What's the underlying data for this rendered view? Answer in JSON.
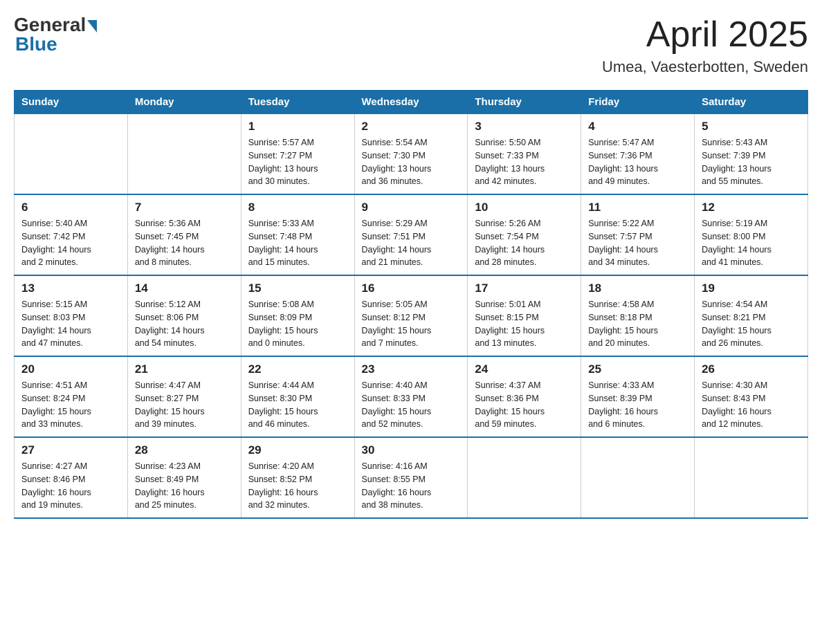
{
  "logo": {
    "general": "General",
    "blue": "Blue"
  },
  "title": "April 2025",
  "subtitle": "Umea, Vaesterbotten, Sweden",
  "days_of_week": [
    "Sunday",
    "Monday",
    "Tuesday",
    "Wednesday",
    "Thursday",
    "Friday",
    "Saturday"
  ],
  "weeks": [
    [
      {
        "day": "",
        "info": ""
      },
      {
        "day": "",
        "info": ""
      },
      {
        "day": "1",
        "info": "Sunrise: 5:57 AM\nSunset: 7:27 PM\nDaylight: 13 hours\nand 30 minutes."
      },
      {
        "day": "2",
        "info": "Sunrise: 5:54 AM\nSunset: 7:30 PM\nDaylight: 13 hours\nand 36 minutes."
      },
      {
        "day": "3",
        "info": "Sunrise: 5:50 AM\nSunset: 7:33 PM\nDaylight: 13 hours\nand 42 minutes."
      },
      {
        "day": "4",
        "info": "Sunrise: 5:47 AM\nSunset: 7:36 PM\nDaylight: 13 hours\nand 49 minutes."
      },
      {
        "day": "5",
        "info": "Sunrise: 5:43 AM\nSunset: 7:39 PM\nDaylight: 13 hours\nand 55 minutes."
      }
    ],
    [
      {
        "day": "6",
        "info": "Sunrise: 5:40 AM\nSunset: 7:42 PM\nDaylight: 14 hours\nand 2 minutes."
      },
      {
        "day": "7",
        "info": "Sunrise: 5:36 AM\nSunset: 7:45 PM\nDaylight: 14 hours\nand 8 minutes."
      },
      {
        "day": "8",
        "info": "Sunrise: 5:33 AM\nSunset: 7:48 PM\nDaylight: 14 hours\nand 15 minutes."
      },
      {
        "day": "9",
        "info": "Sunrise: 5:29 AM\nSunset: 7:51 PM\nDaylight: 14 hours\nand 21 minutes."
      },
      {
        "day": "10",
        "info": "Sunrise: 5:26 AM\nSunset: 7:54 PM\nDaylight: 14 hours\nand 28 minutes."
      },
      {
        "day": "11",
        "info": "Sunrise: 5:22 AM\nSunset: 7:57 PM\nDaylight: 14 hours\nand 34 minutes."
      },
      {
        "day": "12",
        "info": "Sunrise: 5:19 AM\nSunset: 8:00 PM\nDaylight: 14 hours\nand 41 minutes."
      }
    ],
    [
      {
        "day": "13",
        "info": "Sunrise: 5:15 AM\nSunset: 8:03 PM\nDaylight: 14 hours\nand 47 minutes."
      },
      {
        "day": "14",
        "info": "Sunrise: 5:12 AM\nSunset: 8:06 PM\nDaylight: 14 hours\nand 54 minutes."
      },
      {
        "day": "15",
        "info": "Sunrise: 5:08 AM\nSunset: 8:09 PM\nDaylight: 15 hours\nand 0 minutes."
      },
      {
        "day": "16",
        "info": "Sunrise: 5:05 AM\nSunset: 8:12 PM\nDaylight: 15 hours\nand 7 minutes."
      },
      {
        "day": "17",
        "info": "Sunrise: 5:01 AM\nSunset: 8:15 PM\nDaylight: 15 hours\nand 13 minutes."
      },
      {
        "day": "18",
        "info": "Sunrise: 4:58 AM\nSunset: 8:18 PM\nDaylight: 15 hours\nand 20 minutes."
      },
      {
        "day": "19",
        "info": "Sunrise: 4:54 AM\nSunset: 8:21 PM\nDaylight: 15 hours\nand 26 minutes."
      }
    ],
    [
      {
        "day": "20",
        "info": "Sunrise: 4:51 AM\nSunset: 8:24 PM\nDaylight: 15 hours\nand 33 minutes."
      },
      {
        "day": "21",
        "info": "Sunrise: 4:47 AM\nSunset: 8:27 PM\nDaylight: 15 hours\nand 39 minutes."
      },
      {
        "day": "22",
        "info": "Sunrise: 4:44 AM\nSunset: 8:30 PM\nDaylight: 15 hours\nand 46 minutes."
      },
      {
        "day": "23",
        "info": "Sunrise: 4:40 AM\nSunset: 8:33 PM\nDaylight: 15 hours\nand 52 minutes."
      },
      {
        "day": "24",
        "info": "Sunrise: 4:37 AM\nSunset: 8:36 PM\nDaylight: 15 hours\nand 59 minutes."
      },
      {
        "day": "25",
        "info": "Sunrise: 4:33 AM\nSunset: 8:39 PM\nDaylight: 16 hours\nand 6 minutes."
      },
      {
        "day": "26",
        "info": "Sunrise: 4:30 AM\nSunset: 8:43 PM\nDaylight: 16 hours\nand 12 minutes."
      }
    ],
    [
      {
        "day": "27",
        "info": "Sunrise: 4:27 AM\nSunset: 8:46 PM\nDaylight: 16 hours\nand 19 minutes."
      },
      {
        "day": "28",
        "info": "Sunrise: 4:23 AM\nSunset: 8:49 PM\nDaylight: 16 hours\nand 25 minutes."
      },
      {
        "day": "29",
        "info": "Sunrise: 4:20 AM\nSunset: 8:52 PM\nDaylight: 16 hours\nand 32 minutes."
      },
      {
        "day": "30",
        "info": "Sunrise: 4:16 AM\nSunset: 8:55 PM\nDaylight: 16 hours\nand 38 minutes."
      },
      {
        "day": "",
        "info": ""
      },
      {
        "day": "",
        "info": ""
      },
      {
        "day": "",
        "info": ""
      }
    ]
  ]
}
